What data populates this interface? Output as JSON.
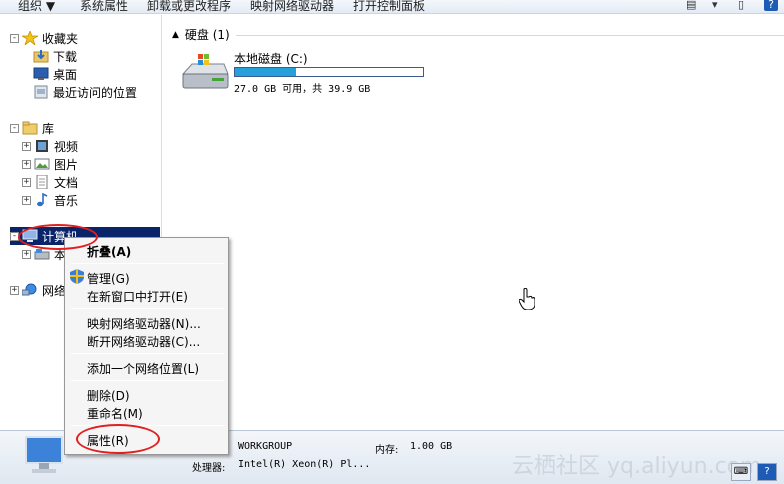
{
  "toolbar": {
    "organize": "组织 ▼",
    "system_properties": "系统属性",
    "uninstall": "卸载或更改程序",
    "map_drive": "映射网络驱动器",
    "open_control_panel": "打开控制面板"
  },
  "nav": {
    "favorites": "收藏夹",
    "downloads": "下载",
    "desktop": "桌面",
    "recent": "最近访问的位置",
    "libraries": "库",
    "videos": "视频",
    "pictures": "图片",
    "documents": "文档",
    "music": "音乐",
    "computer": "计算机",
    "local_disk_partial": "本",
    "network_partial": "网络"
  },
  "content": {
    "group_header": "硬盘 (1)",
    "drive_name": "本地磁盘 (C:)",
    "drive_free_text": "27.0 GB 可用，共 39.9 GB",
    "drive_used_fraction": 0.323
  },
  "context_menu": {
    "collapse": "折叠(A)",
    "manage": "管理(G)",
    "open_new_window": "在新窗口中打开(E)",
    "map_network_drive": "映射网络驱动器(N)...",
    "disconnect_network_drive": "断开网络驱动器(C)...",
    "add_network_location": "添加一个网络位置(L)",
    "delete": "删除(D)",
    "rename": "重命名(M)",
    "properties": "属性(R)"
  },
  "details": {
    "workgroup_label": ":",
    "workgroup_value": "WORKGROUP",
    "memory_label": "内存:",
    "memory_value": "1.00 GB",
    "processor_label": "处理器:",
    "processor_value": "Intel(R) Xeon(R) Pl..."
  },
  "watermark": "云栖社区 yq.aliyun.com",
  "colors": {
    "selection": "#0a246a",
    "bar_fill": "#26a0da",
    "annotation": "#e02020"
  }
}
